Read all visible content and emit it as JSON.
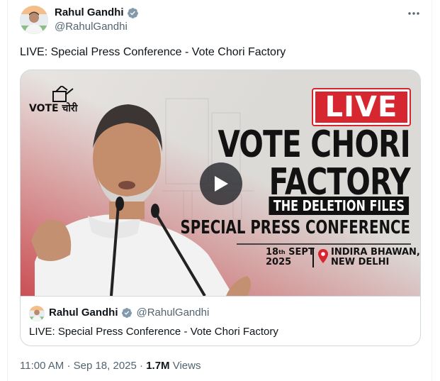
{
  "author": {
    "name": "Rahul Gandhi",
    "handle": "@RahulGandhi",
    "verified": true,
    "avatar_icon": "profile-photo"
  },
  "tweet": {
    "text": "LIVE: Special Press Conference - Vote Chori Factory"
  },
  "media": {
    "type": "video",
    "logo_text": "VOTE चोरी",
    "live_badge": "LIVE",
    "headline_line1": "VOTE CHORI",
    "headline_line2": "FACTORY",
    "subtitle": "THE DELETION FILES",
    "event": "SPECIAL PRESS CONFERENCE",
    "date_day": "18",
    "date_suffix": "th",
    "date_month": " SEPT",
    "date_year": "2025",
    "venue_line1": "INDIRA BHAWAN,",
    "venue_line2": "NEW DELHI",
    "accent_color": "#d6262f"
  },
  "quoted": {
    "name": "Rahul Gandhi",
    "handle": "@RahulGandhi",
    "text": "LIVE: Special Press Conference - Vote Chori Factory"
  },
  "meta": {
    "time": "11:00 AM",
    "separator": "·",
    "date": "Sep 18, 2025",
    "views_count": "1.7M",
    "views_label": "Views"
  },
  "colors": {
    "verified_blue": "#1d9bf0",
    "text_secondary": "#536471",
    "border": "#cfd9de"
  }
}
